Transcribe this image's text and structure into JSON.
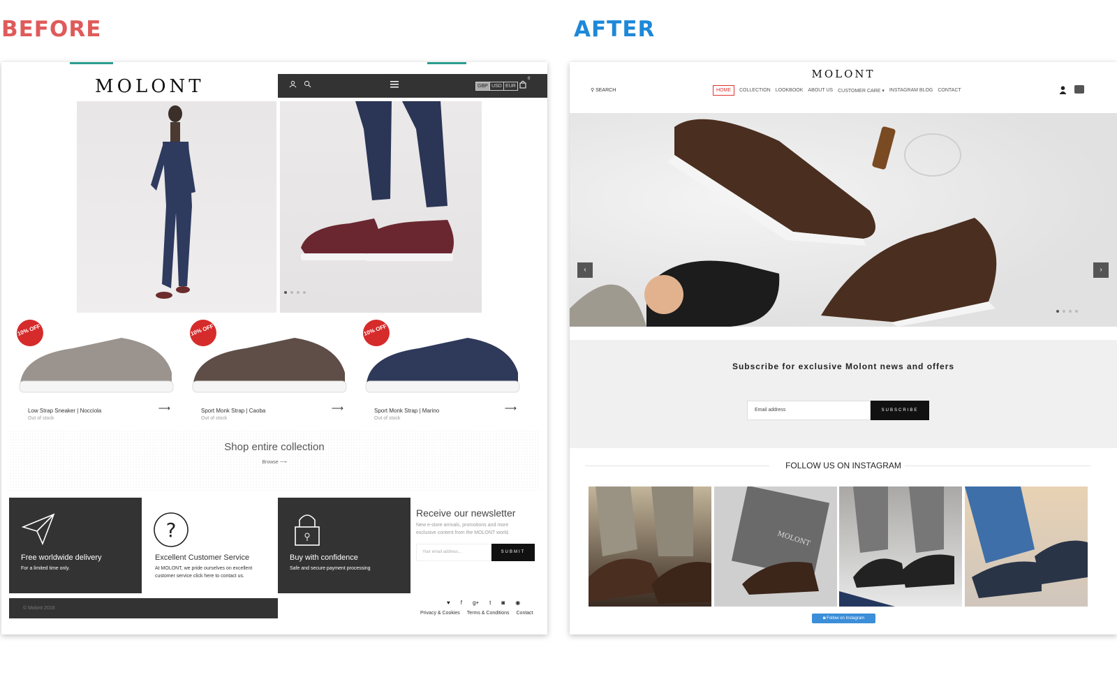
{
  "labels": {
    "before": "BEFORE",
    "after": "AFTER"
  },
  "before": {
    "logo": "MOLONT",
    "currencies": [
      "GBP",
      "USD",
      "EUR"
    ],
    "cart_count": "0",
    "badge": "10% OFF",
    "products": [
      {
        "name": "Low Strap Sneaker | Nocciola",
        "status": "Out of stock",
        "color": "#9a938e"
      },
      {
        "name": "Sport Monk Strap | Caoba",
        "status": "Out of stock",
        "color": "#5e4e47"
      },
      {
        "name": "Sport Monk Strap | Marino",
        "status": "Out of stock",
        "color": "#2f3a5a"
      }
    ],
    "shop": {
      "title": "Shop entire collection",
      "browse": "Browse ⟶"
    },
    "features": [
      {
        "title": "Free worldwide delivery",
        "desc": "For a limited time only."
      },
      {
        "title": "Excellent Customer Service",
        "desc": "At MOLONT, we pride ourselves on excellent customer service click here to contact us."
      },
      {
        "title": "Buy with confidence",
        "desc": "Safe and secure payment processing"
      }
    ],
    "newsletter": {
      "title": "Receive our newsletter",
      "desc": "New e-store arrivals, promotions and more exclusive content from the MOLONT world.",
      "placeholder": "Your email address...",
      "button": "SUBMIT"
    },
    "footer": {
      "copyright": "© Molont 2016",
      "links": [
        "Privacy & Cookies",
        "Terms & Conditions",
        "Contact"
      ]
    }
  },
  "after": {
    "logo": "MOLONT",
    "search": "SEARCH",
    "nav": [
      "HOME",
      "COLLECTION",
      "LOOKBOOK",
      "ABOUT US",
      "CUSTOMER CARE ▾",
      "INSTAGRAM BLOG",
      "CONTACT"
    ],
    "subscribe": {
      "heading": "Subscribe for exclusive Molont news and offers",
      "placeholder": "Email address",
      "button": "SUBSCRIBE"
    },
    "instagram": {
      "title": "FOLLOW US ON INSTAGRAM",
      "button": "Follow on Instagram",
      "box_brand": "MOLONT"
    },
    "colors": {
      "accent": "#d33333",
      "instagram_blue": "#3b8ed8"
    }
  }
}
